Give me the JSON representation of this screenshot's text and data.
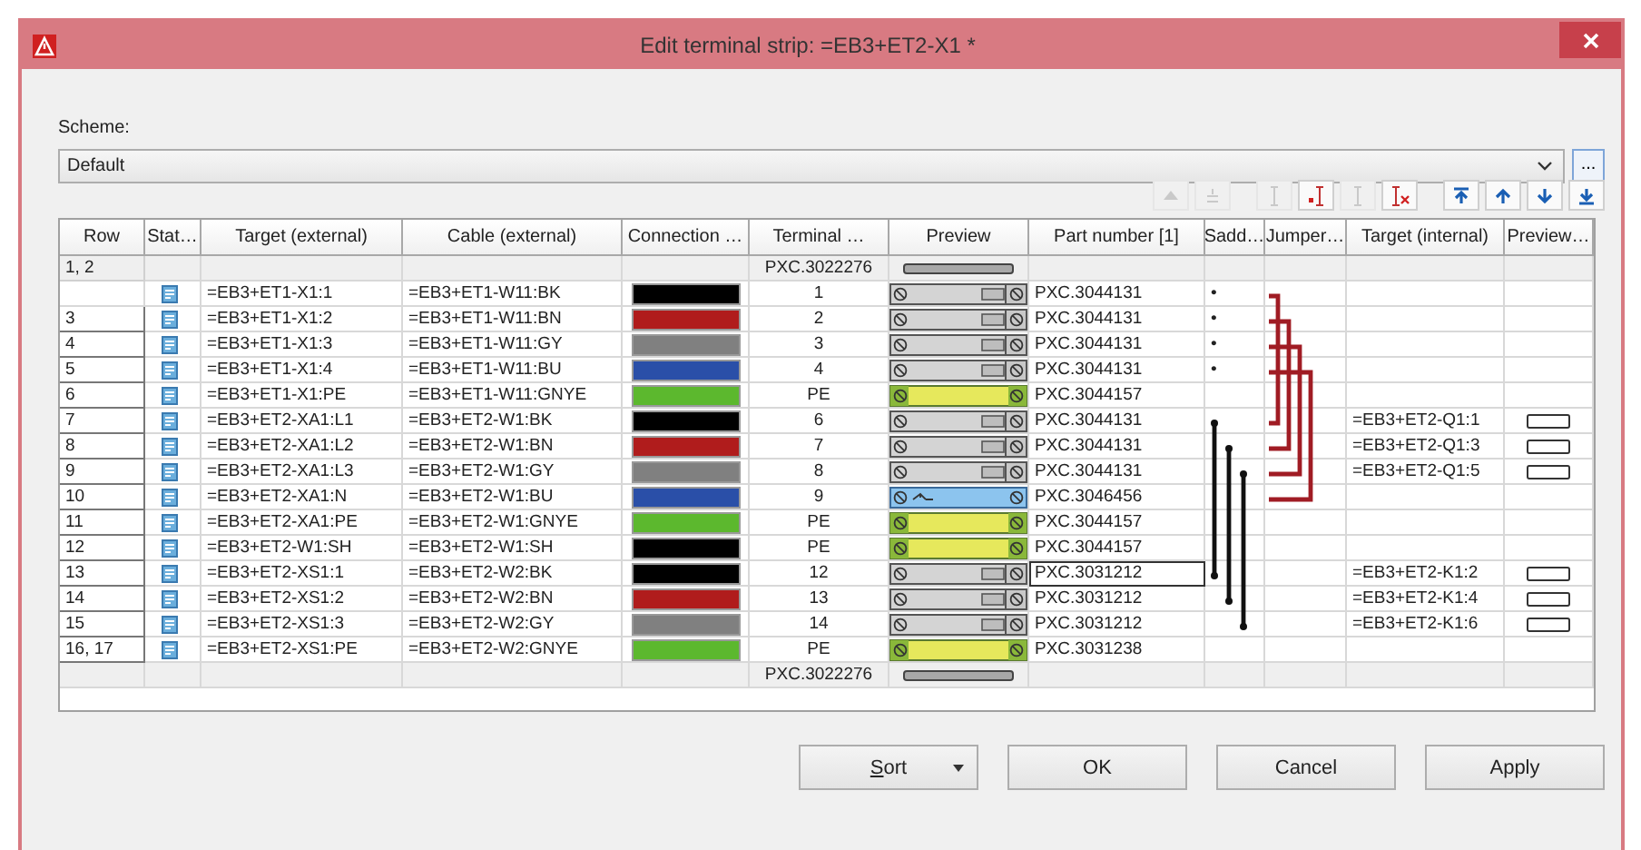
{
  "window": {
    "title": "Edit terminal strip: =EB3+ET2-X1 *"
  },
  "scheme": {
    "label": "Scheme:",
    "value": "Default",
    "browse": "..."
  },
  "toolbar": [
    {
      "kind": "triangle-up",
      "disabled": true
    },
    {
      "kind": "equal",
      "disabled": true
    },
    {
      "kind": "ibeam",
      "disabled": true
    },
    {
      "kind": "dot-ibeam",
      "disabled": false
    },
    {
      "kind": "ibeam",
      "disabled": true
    },
    {
      "kind": "ibeam-x",
      "disabled": false
    },
    {
      "kind": "to-top",
      "disabled": false
    },
    {
      "kind": "up",
      "disabled": false
    },
    {
      "kind": "down",
      "disabled": false
    },
    {
      "kind": "to-bottom",
      "disabled": false
    }
  ],
  "table": {
    "columns": [
      "Row",
      "Stat…",
      "Target (external)",
      "Cable (external)",
      "Connection …",
      "Terminal …",
      "Preview",
      "Part number [1]",
      "Sadd…",
      "Jumper…",
      "Target (internal)",
      "Preview…"
    ],
    "rows": [
      {
        "kind": "strip",
        "row": "1, 2",
        "status": false,
        "terminal": "PXC.3022276",
        "preview": {
          "kind": "end"
        },
        "connector": false,
        "focused": false
      },
      {
        "kind": "terminal",
        "status": true,
        "target": "=EB3+ET1-X1:1",
        "cable": "=EB3+ET1-W11:BK",
        "color": "#000000",
        "terminal": "1",
        "preview": {
          "kind": "standard"
        },
        "part": "PXC.3044131",
        "saddle": "•",
        "connector": false,
        "focused": false
      },
      {
        "kind": "terminal",
        "row": "3",
        "status": true,
        "target": "=EB3+ET1-X1:2",
        "cable": "=EB3+ET1-W11:BN",
        "color": "#b01c1c",
        "terminal": "2",
        "preview": {
          "kind": "standard"
        },
        "part": "PXC.3044131",
        "saddle": "•",
        "connector": false,
        "focused": false
      },
      {
        "kind": "terminal",
        "row": "4",
        "status": true,
        "target": "=EB3+ET1-X1:3",
        "cable": "=EB3+ET1-W11:GY",
        "color": "#808080",
        "terminal": "3",
        "preview": {
          "kind": "standard"
        },
        "part": "PXC.3044131",
        "saddle": "•",
        "connector": false,
        "focused": false
      },
      {
        "kind": "terminal",
        "row": "5",
        "status": true,
        "target": "=EB3+ET1-X1:4",
        "cable": "=EB3+ET1-W11:BU",
        "color": "#2a4fa8",
        "terminal": "4",
        "preview": {
          "kind": "standard"
        },
        "part": "PXC.3044131",
        "saddle": "•",
        "connector": false,
        "focused": false
      },
      {
        "kind": "terminal",
        "row": "6",
        "status": true,
        "target": "=EB3+ET1-X1:PE",
        "cable": "=EB3+ET1-W11:GNYE",
        "color": "#5cb82e",
        "terminal": "PE",
        "preview": {
          "kind": "pe"
        },
        "part": "PXC.3044157",
        "connector": false,
        "focused": false
      },
      {
        "kind": "terminal",
        "row": "7",
        "status": true,
        "target": "=EB3+ET2-XA1:L1",
        "cable": "=EB3+ET2-W1:BK",
        "color": "#000000",
        "terminal": "6",
        "preview": {
          "kind": "standard"
        },
        "part": "PXC.3044131",
        "target_internal": "=EB3+ET2-Q1:1",
        "connector": true,
        "focused": false
      },
      {
        "kind": "terminal",
        "row": "8",
        "status": true,
        "target": "=EB3+ET2-XA1:L2",
        "cable": "=EB3+ET2-W1:BN",
        "color": "#b01c1c",
        "terminal": "7",
        "preview": {
          "kind": "standard"
        },
        "part": "PXC.3044131",
        "target_internal": "=EB3+ET2-Q1:3",
        "connector": true,
        "focused": false
      },
      {
        "kind": "terminal",
        "row": "9",
        "status": true,
        "target": "=EB3+ET2-XA1:L3",
        "cable": "=EB3+ET2-W1:GY",
        "color": "#808080",
        "terminal": "8",
        "preview": {
          "kind": "standard"
        },
        "part": "PXC.3044131",
        "target_internal": "=EB3+ET2-Q1:5",
        "connector": true,
        "focused": false
      },
      {
        "kind": "terminal",
        "row": "10",
        "status": true,
        "target": "=EB3+ET2-XA1:N",
        "cable": "=EB3+ET2-W1:BU",
        "color": "#2a4fa8",
        "terminal": "9",
        "preview": {
          "kind": "n"
        },
        "part": "PXC.3046456",
        "connector": false,
        "focused": false
      },
      {
        "kind": "terminal",
        "row": "11",
        "status": true,
        "target": "=EB3+ET2-XA1:PE",
        "cable": "=EB3+ET2-W1:GNYE",
        "color": "#5cb82e",
        "terminal": "PE",
        "preview": {
          "kind": "pe"
        },
        "part": "PXC.3044157",
        "connector": false,
        "focused": false
      },
      {
        "kind": "terminal",
        "row": "12",
        "status": true,
        "target": "=EB3+ET2-W1:SH",
        "cable": "=EB3+ET2-W1:SH",
        "color": "#000000",
        "terminal": "PE",
        "preview": {
          "kind": "pe"
        },
        "part": "PXC.3044157",
        "connector": false,
        "focused": false
      },
      {
        "kind": "terminal",
        "row": "13",
        "status": true,
        "target": "=EB3+ET2-XS1:1",
        "cable": "=EB3+ET2-W2:BK",
        "color": "#000000",
        "terminal": "12",
        "preview": {
          "kind": "standard"
        },
        "part": "PXC.3031212",
        "target_internal": "=EB3+ET2-K1:2",
        "connector": true,
        "focused": true
      },
      {
        "kind": "terminal",
        "row": "14",
        "status": true,
        "target": "=EB3+ET2-XS1:2",
        "cable": "=EB3+ET2-W2:BN",
        "color": "#b01c1c",
        "terminal": "13",
        "preview": {
          "kind": "standard"
        },
        "part": "PXC.3031212",
        "target_internal": "=EB3+ET2-K1:4",
        "connector": true,
        "focused": false
      },
      {
        "kind": "terminal",
        "row": "15",
        "status": true,
        "target": "=EB3+ET2-XS1:3",
        "cable": "=EB3+ET2-W2:GY",
        "color": "#808080",
        "terminal": "14",
        "preview": {
          "kind": "standard"
        },
        "part": "PXC.3031212",
        "target_internal": "=EB3+ET2-K1:6",
        "connector": true,
        "focused": false
      },
      {
        "kind": "terminal",
        "row": "16, 17",
        "status": true,
        "target": "=EB3+ET2-XS1:PE",
        "cable": "=EB3+ET2-W2:GNYE",
        "color": "#5cb82e",
        "terminal": "PE",
        "preview": {
          "kind": "pe"
        },
        "part": "PXC.3031238",
        "connector": false,
        "focused": false
      },
      {
        "kind": "strip",
        "status": false,
        "terminal": "PXC.3022276",
        "preview": {
          "kind": "end"
        },
        "connector": false,
        "focused": false
      }
    ]
  },
  "buttons": [
    {
      "label": "Sort",
      "kind": "dropdown"
    },
    {
      "label": "OK",
      "kind": "plain"
    },
    {
      "label": "Cancel",
      "kind": "plain"
    },
    {
      "label": "Apply",
      "kind": "plain"
    }
  ]
}
